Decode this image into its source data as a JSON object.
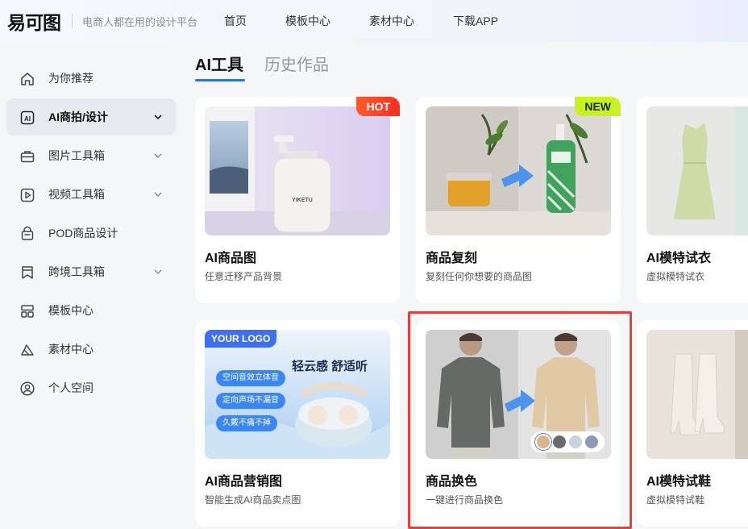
{
  "header": {
    "logo": "易可图",
    "tagline": "电商人都在用的设计平台",
    "nav": [
      "首页",
      "模板中心",
      "素材中心",
      "下载APP"
    ]
  },
  "sidebar": {
    "items": [
      {
        "label": "为你推荐",
        "icon": "home-icon",
        "chevron": false,
        "active": false
      },
      {
        "label": "AI商拍/设计",
        "icon": "ai-icon",
        "chevron": true,
        "active": true
      },
      {
        "label": "图片工具箱",
        "icon": "toolbox-icon",
        "chevron": true,
        "active": false
      },
      {
        "label": "视频工具箱",
        "icon": "video-play-icon",
        "chevron": true,
        "active": false
      },
      {
        "label": "POD商品设计",
        "icon": "bag-icon",
        "chevron": false,
        "active": false
      },
      {
        "label": "跨境工具箱",
        "icon": "bookmark-icon",
        "chevron": true,
        "active": false
      },
      {
        "label": "模板中心",
        "icon": "layout-grid-icon",
        "chevron": false,
        "active": false
      },
      {
        "label": "素材中心",
        "icon": "shapes-icon",
        "chevron": false,
        "active": false
      },
      {
        "label": "个人空间",
        "icon": "user-circle-icon",
        "chevron": false,
        "active": false
      }
    ]
  },
  "main": {
    "tabs": [
      {
        "label": "AI工具",
        "active": true
      },
      {
        "label": "历史作品",
        "active": false
      }
    ],
    "cards": [
      {
        "title": "AI商品图",
        "desc": "任意迁移产品背景",
        "badge": "HOT",
        "bottle_text": "YIKETU"
      },
      {
        "title": "商品复刻",
        "desc": "复刻任何你想要的商品图",
        "badge": "NEW"
      },
      {
        "title": "AI模特试衣",
        "desc": "虚拟模特试衣"
      },
      {
        "title": "AI商品营销图",
        "desc": "智能生成AI商品卖点图",
        "logo_badge": "YOUR LOGO",
        "promo_title": "轻云感 舒适听",
        "pills": [
          "空间音效立体音",
          "定向声场不漏音",
          "久戴不痛不掉"
        ]
      },
      {
        "title": "商品换色",
        "desc": "一键进行商品换色",
        "highlighted": true,
        "swatches": [
          "#d9b48c",
          "#6b6b6b",
          "#c9d3e0",
          "#8e98b8"
        ]
      },
      {
        "title": "AI模特试鞋",
        "desc": "虚拟模特试鞋"
      }
    ]
  },
  "colors": {
    "accent": "#2f6fe8",
    "highlight_border": "#e5413b",
    "hot_badge": "#ff3b24",
    "new_badge": "#c8f21e"
  }
}
